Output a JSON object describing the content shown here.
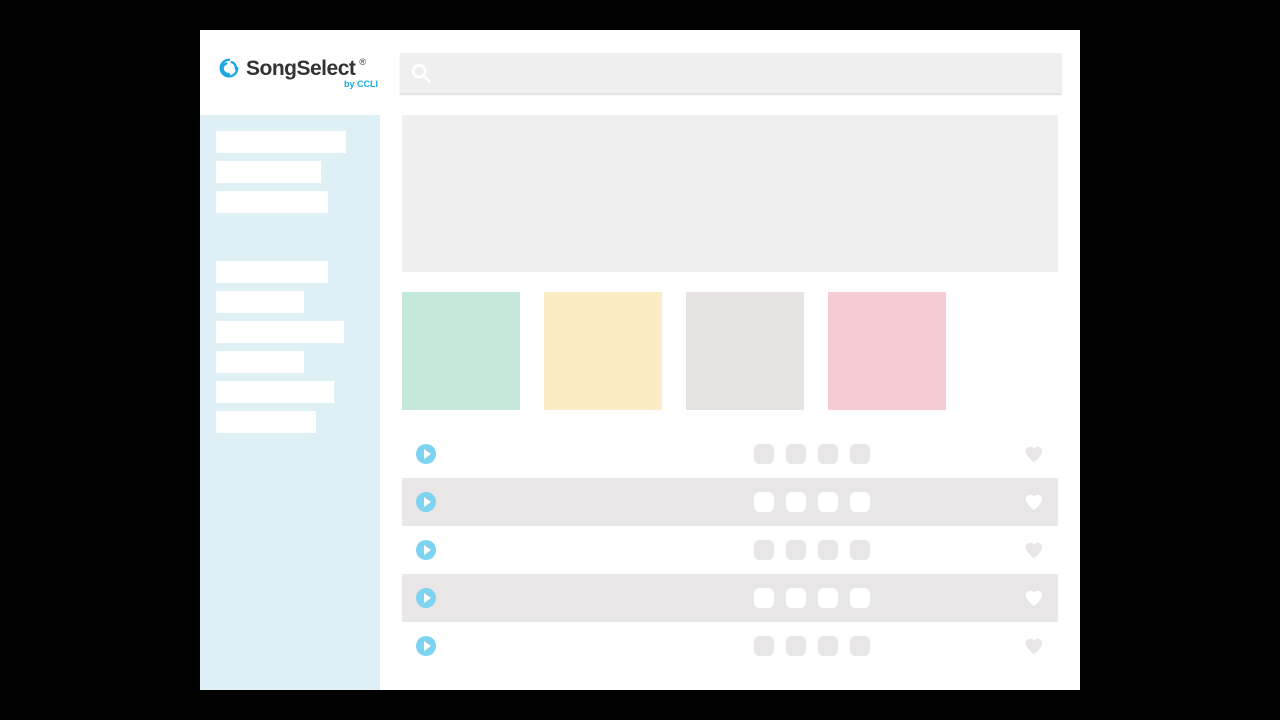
{
  "brand": {
    "name": "SongSelect",
    "registered": "®",
    "subtitle": "by CCLI"
  },
  "search": {
    "placeholder": ""
  },
  "sidebar": {
    "groups": [
      {
        "items": [
          {
            "width_class": "w1"
          },
          {
            "width_class": "w2"
          },
          {
            "width_class": "w3"
          }
        ]
      },
      {
        "items": [
          {
            "width_class": "w4"
          },
          {
            "width_class": "w5"
          },
          {
            "width_class": "w6"
          },
          {
            "width_class": "w7"
          },
          {
            "width_class": "w8"
          },
          {
            "width_class": "w9"
          }
        ]
      }
    ]
  },
  "cards": [
    {
      "color": "card-green"
    },
    {
      "color": "card-cream"
    },
    {
      "color": "card-grey"
    },
    {
      "color": "card-pink"
    }
  ],
  "tracks": [
    {
      "alt": false
    },
    {
      "alt": true
    },
    {
      "alt": false
    },
    {
      "alt": true
    },
    {
      "alt": false
    }
  ],
  "colors": {
    "accent": "#7ed3f1",
    "brand_blue": "#1ba8e0",
    "sidebar_bg": "#def0f6"
  }
}
